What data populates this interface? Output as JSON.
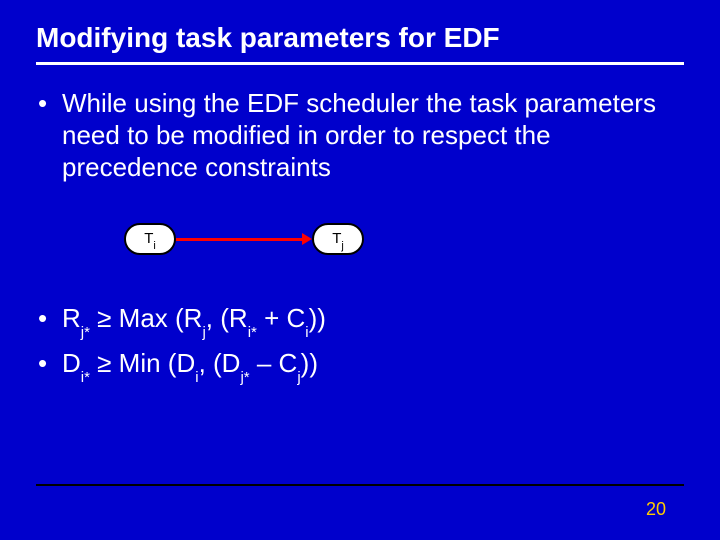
{
  "title": "Modifying task parameters for EDF",
  "bullet1": "While using the EDF scheduler the task parameters need to be modified in order to respect the precedence constraints",
  "diagram": {
    "left_node_base": "T",
    "left_node_sub": "i",
    "right_node_base": "T",
    "right_node_sub": "j"
  },
  "formula1": {
    "lhs_base": "R",
    "lhs_sub": "j*",
    "op": " ≥ Max (R",
    "a_sub": "j",
    "mid": ", (R",
    "b_sub": "i*",
    "mid2": " + C",
    "c_sub": "i",
    "tail": "))"
  },
  "formula2": {
    "lhs_base": "D",
    "lhs_sub": "i*",
    "op": " ≥ Min (D",
    "a_sub": "i",
    "mid": ", (D",
    "b_sub": "j*",
    "mid2": " – C",
    "c_sub": "j",
    "tail": "))"
  },
  "page_number": "20",
  "bullet_glyph": "•"
}
